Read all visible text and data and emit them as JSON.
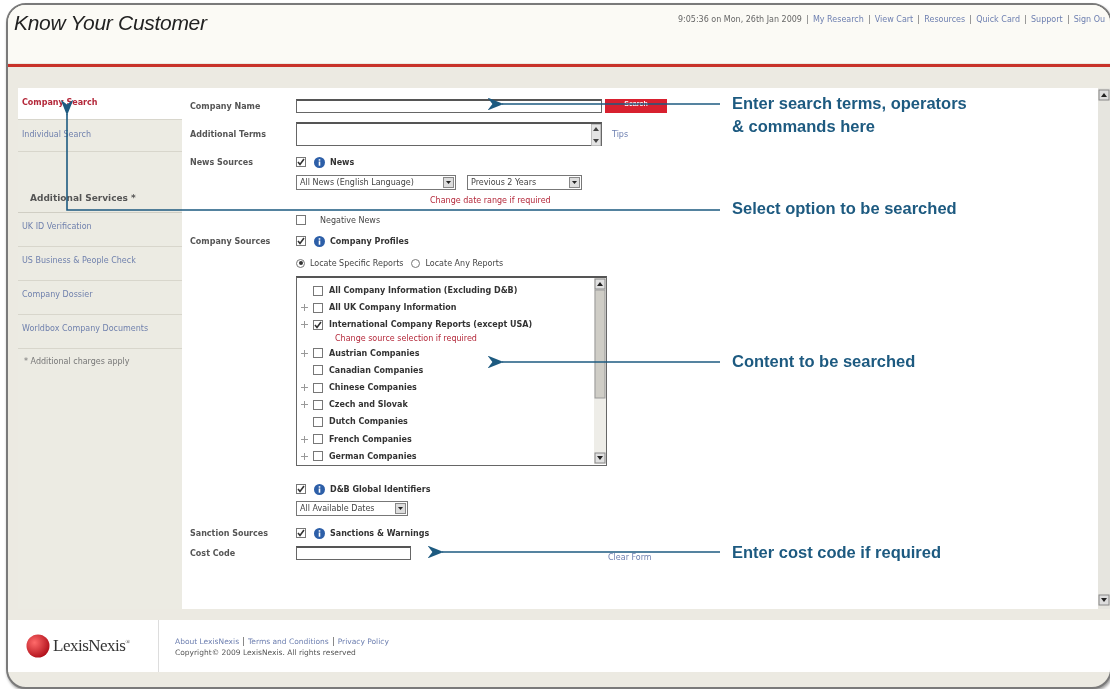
{
  "header": {
    "title": "Know Your Customer",
    "timestamp": "9:05:36 on Mon, 26th Jan 2009",
    "links": [
      "My Research",
      "View Cart",
      "Resources",
      "Quick Card",
      "Support",
      "Sign Ou"
    ]
  },
  "sidebar": {
    "tabs": [
      {
        "label": "Company Search",
        "selected": true
      },
      {
        "label": "Individual Search",
        "selected": false
      }
    ],
    "services_title": "Additional Services *",
    "services": [
      "UK ID Verification",
      "US Business & People Check",
      "Company Dossier",
      "Worldbox Company Documents"
    ],
    "note": "* Additional charges apply"
  },
  "form": {
    "company_name": {
      "label": "Company Name",
      "button": "Search"
    },
    "additional_terms": {
      "label": "Additional Terms",
      "link": "Tips"
    },
    "news_sources": {
      "label": "News Sources",
      "checked": true,
      "source": "News",
      "dropdowns": [
        "All News (English Language)",
        "Previous 2 Years"
      ],
      "hint": "Change date range if required",
      "negative_news": {
        "label": "Negative News",
        "checked": false
      }
    },
    "company_sources": {
      "label": "Company Sources",
      "checked": true,
      "source": "Company Profiles",
      "radios": [
        {
          "label": "Locate Specific Reports",
          "selected": true
        },
        {
          "label": "Locate Any Reports",
          "selected": false
        }
      ],
      "items": [
        {
          "label": "All Company Information (Excluding D&B)",
          "checked": false,
          "expandable": false
        },
        {
          "label": "All UK Company Information",
          "checked": false,
          "expandable": true
        },
        {
          "label": "International Company Reports (except USA)",
          "checked": true,
          "expandable": true,
          "hint": "Change source selection if required"
        },
        {
          "label": "Austrian Companies",
          "checked": false,
          "expandable": true
        },
        {
          "label": "Canadian Companies",
          "checked": false,
          "expandable": false
        },
        {
          "label": "Chinese Companies",
          "checked": false,
          "expandable": true
        },
        {
          "label": "Czech and Slovak",
          "checked": false,
          "expandable": true
        },
        {
          "label": "Dutch Companies",
          "checked": false,
          "expandable": false
        },
        {
          "label": "French Companies",
          "checked": false,
          "expandable": true
        },
        {
          "label": "German Companies",
          "checked": false,
          "expandable": true
        }
      ],
      "dnb": {
        "checked": true,
        "source": "D&B Global Identifiers",
        "dropdown": "All Available Dates"
      }
    },
    "sanction_sources": {
      "label": "Sanction Sources",
      "checked": true,
      "source": "Sanctions & Warnings"
    },
    "cost_code": {
      "label": "Cost Code",
      "link": "Clear Form"
    }
  },
  "footer": {
    "logo": "LexisNexis$^{®}$",
    "links": [
      "About LexisNexis",
      "Terms and Conditions",
      "Privacy Policy"
    ],
    "copyright": "Copyright© 2009 LexisNexis. All rights reserved"
  },
  "callouts": [
    {
      "text": "Enter search terms, operators & commands here"
    },
    {
      "text": "Select option to be searched"
    },
    {
      "text": "Content to be searched"
    },
    {
      "text": "Enter cost code if required"
    }
  ]
}
